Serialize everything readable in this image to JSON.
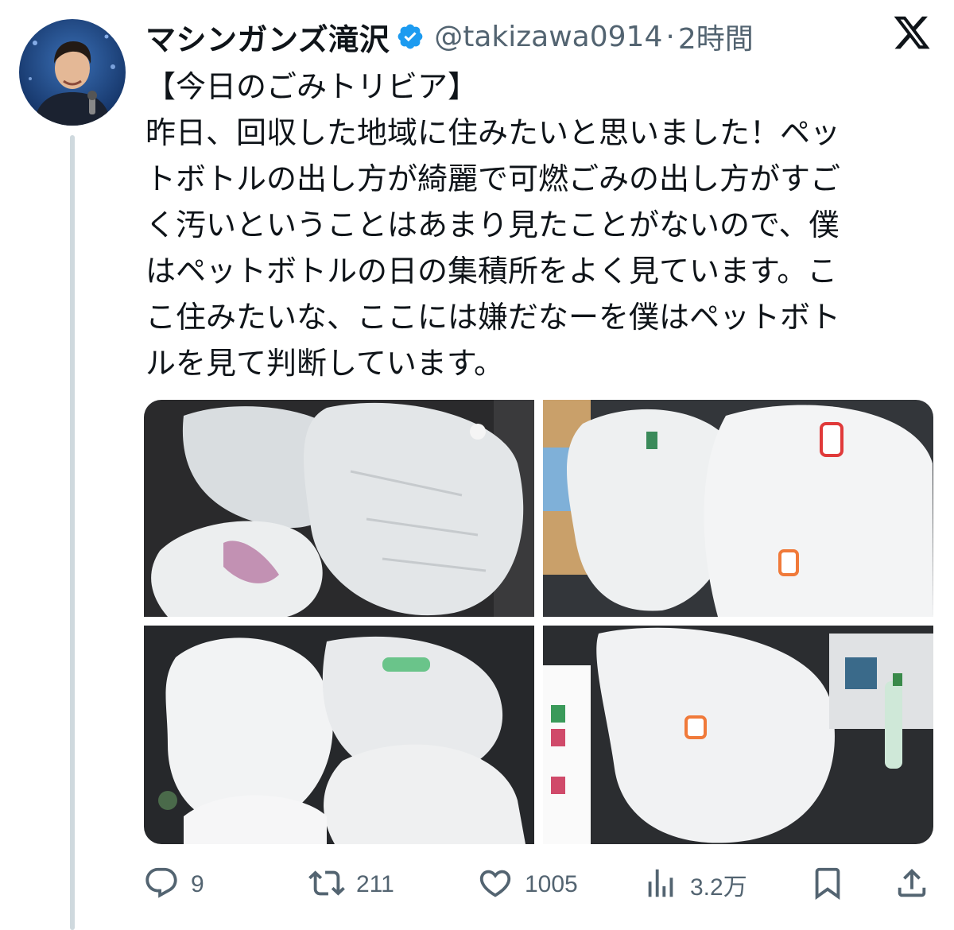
{
  "author": {
    "display_name": "マシンガンズ滝沢",
    "handle": "@takizawa0914",
    "separator": "·",
    "time": "2時間"
  },
  "tweet": {
    "lines": [
      "【今日のごみトリビア】",
      "昨日、回収した地域に住みたいと思いました！ペッ",
      "トボトルの出し方が綺麗で可燃ごみの出し方がすご",
      "く汚いということはあまり見たことがないので、僕",
      "はペットボトルの日の集積所をよく見ています。こ",
      "こ住みたいな、ここには嫌だなーを僕はペットボト",
      "ルを見て判断しています。"
    ]
  },
  "actions": {
    "replies": "9",
    "retweets": "211",
    "likes": "1005",
    "views": "3.2万"
  },
  "icons": {
    "verified": "verified-badge-icon",
    "brand": "x-logo-icon",
    "reply": "reply-icon",
    "retweet": "retweet-icon",
    "like": "heart-icon",
    "views": "views-chart-icon",
    "bookmark": "bookmark-icon",
    "share": "share-icon"
  },
  "colors": {
    "verified": "#1d9bf0",
    "text": "#0f1419",
    "muted": "#536471",
    "thread_line": "#cfd9de"
  }
}
